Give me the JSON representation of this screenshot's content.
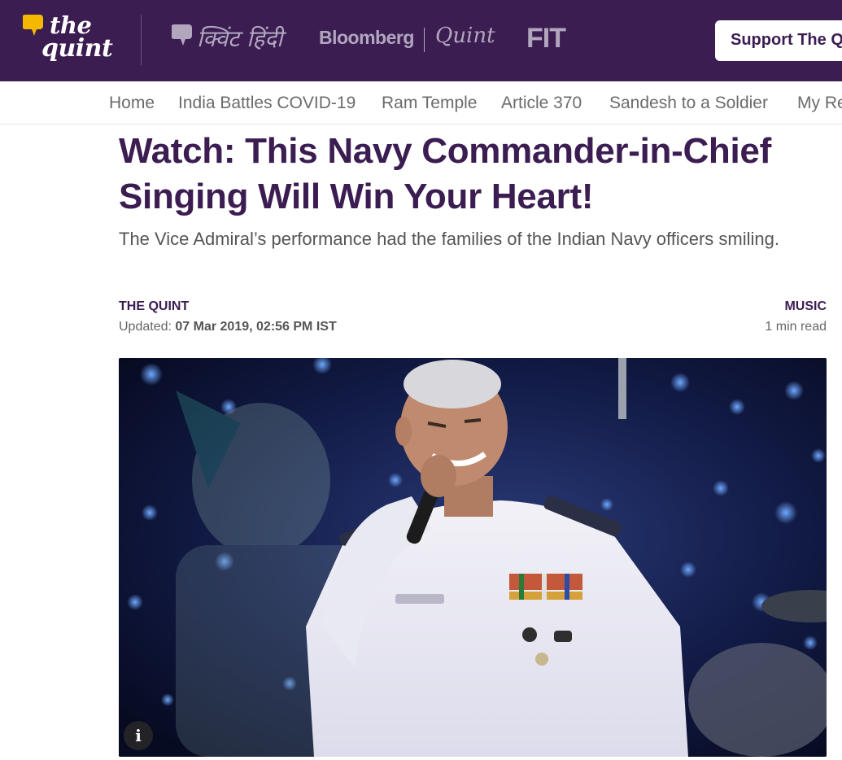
{
  "header": {
    "logo_the": "the",
    "logo_quint": "quint",
    "hindi_logo": "क्विंट हिंदी",
    "bloomberg": "Bloomberg",
    "bq_quint": "Quint",
    "fit": "FIT",
    "support_label": "Support The Quint"
  },
  "nav": {
    "items": [
      "Home",
      "India Battles COVID-19",
      "Ram Temple",
      "Article 370",
      "Sandesh to a Soldier",
      "My Report"
    ]
  },
  "article": {
    "headline": "Watch: This Navy Commander-in-Chief Singing Will Win Your Heart!",
    "subhead": "The Vice Admiral’s performance had the families of the Indian Navy officers smiling.",
    "author": "THE QUINT",
    "updated_label": "Updated:",
    "updated_date": "07 Mar 2019, 02:56 PM IST",
    "category": "MUSIC",
    "read_time": "1 min read"
  },
  "hero": {
    "info_label": "i"
  },
  "colors": {
    "brand": "#3b1d52",
    "logo_accent": "#f5b800",
    "muted_logo": "#b2a6bf"
  }
}
